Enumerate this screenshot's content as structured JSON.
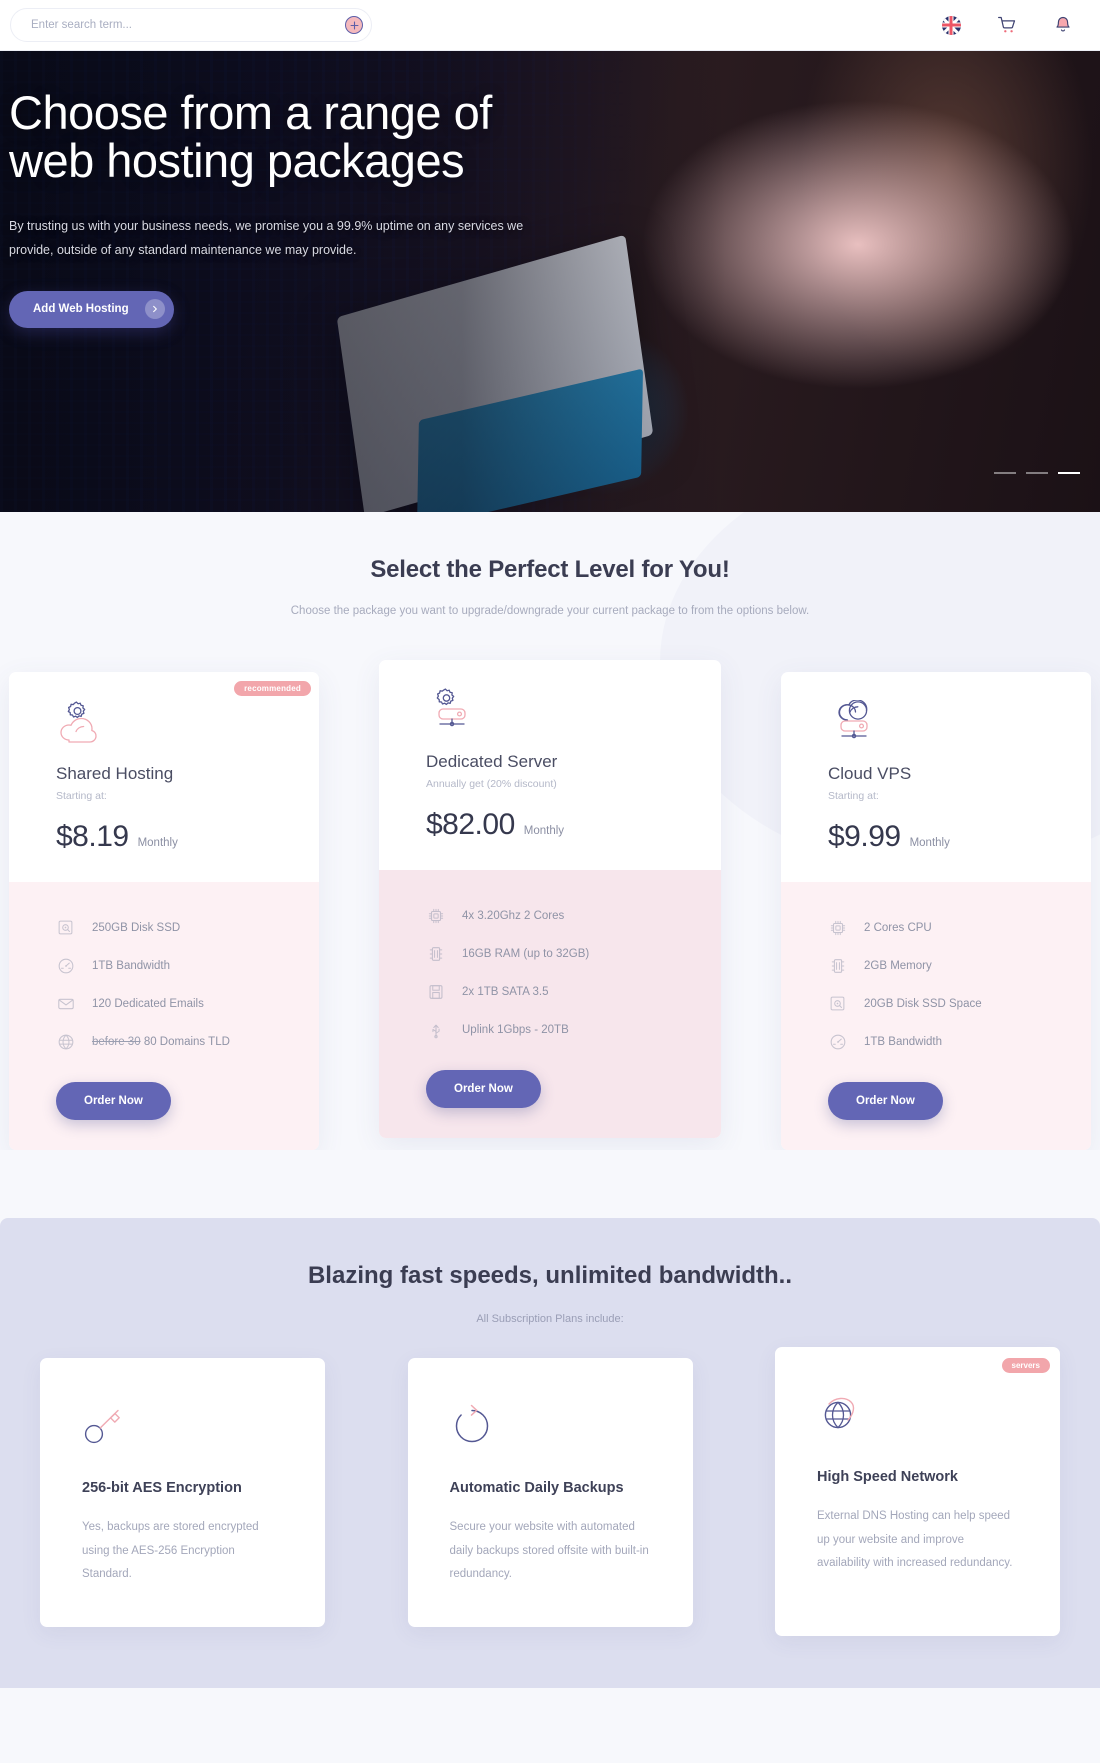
{
  "topbar": {
    "search_placeholder": "Enter search term...",
    "search_value": "",
    "icons": [
      "uk-flag-icon",
      "cart-icon",
      "bell-icon"
    ]
  },
  "hero": {
    "title": "Choose from a range of web hosting packages",
    "subtitle": "By trusting us with your business needs, we promise you a 99.9% uptime on any services we provide, outside of any standard maintenance we may provide.",
    "cta_label": "Add Web Hosting",
    "slides": 3,
    "active_slide": 3
  },
  "pricing": {
    "title": "Select the Perfect Level for You!",
    "subtitle": "Choose the package you want to upgrade/downgrade your current package to from the options below.",
    "cards": [
      {
        "badge": "recommended",
        "icon": "cloud-gear-icon",
        "name": "Shared Hosting",
        "starting_label": "Starting at:",
        "price": "$8.19",
        "period": "Monthly",
        "order_label": "Order Now",
        "features": [
          {
            "icon": "hard-drive-icon",
            "text": "250GB Disk SSD",
            "struck": ""
          },
          {
            "icon": "speedometer-icon",
            "text": "1TB Bandwidth",
            "struck": ""
          },
          {
            "icon": "envelope-icon",
            "text": "120 Dedicated Emails",
            "struck": ""
          },
          {
            "icon": "globe-icon",
            "text": "80 Domains TLD",
            "struck": "before 30"
          }
        ]
      },
      {
        "badge": "",
        "icon": "cloud-server-gear-icon",
        "name": "Dedicated Server",
        "starting_label": "Annually get (20% discount)",
        "price": "$82.00",
        "period": "Monthly",
        "order_label": "Order Now",
        "features": [
          {
            "icon": "cpu-icon",
            "text": "4x 3.20Ghz 2 Cores",
            "struck": ""
          },
          {
            "icon": "memory-icon",
            "text": "16GB RAM (up to 32GB)",
            "struck": ""
          },
          {
            "icon": "disk-icon",
            "text": "2x 1TB SATA 3.5",
            "struck": ""
          },
          {
            "icon": "usb-uplink-icon",
            "text": "Uplink 1Gbps - 20TB",
            "struck": ""
          }
        ]
      },
      {
        "badge": "",
        "icon": "cloud-vps-icon",
        "name": "Cloud VPS",
        "starting_label": "Starting at:",
        "price": "$9.99",
        "period": "Monthly",
        "order_label": "Order Now",
        "features": [
          {
            "icon": "cpu-icon",
            "text": "2 Cores CPU",
            "struck": ""
          },
          {
            "icon": "memory-icon",
            "text": "2GB Memory",
            "struck": ""
          },
          {
            "icon": "hard-drive-icon",
            "text": "20GB Disk SSD Space",
            "struck": ""
          },
          {
            "icon": "speedometer-icon",
            "text": "1TB Bandwidth",
            "struck": ""
          }
        ]
      }
    ]
  },
  "features": {
    "title": "Blazing fast speeds, unlimited bandwidth..",
    "subtitle": "All Subscription Plans include:",
    "cards": [
      {
        "badge": "",
        "icon": "key-icon",
        "name": "256-bit AES Encryption",
        "desc": "Yes, backups are stored encrypted using the AES-256 Encryption Standard."
      },
      {
        "badge": "",
        "icon": "refresh-backup-icon",
        "name": "Automatic Daily Backups",
        "desc": "Secure your website with automated daily backups stored offsite with built-in redundancy."
      },
      {
        "badge": "servers",
        "icon": "globe-network-icon",
        "name": "High Speed Network",
        "desc": "External DNS Hosting can help speed up your website and improve availability with increased redundancy."
      }
    ]
  },
  "colors": {
    "accent_purple": "#6366b5",
    "accent_pink": "#f2a6ab",
    "card_body_pink": "#fdf1f4",
    "features_bg": "#dcdeef",
    "page_bg": "#f7f8fc"
  }
}
